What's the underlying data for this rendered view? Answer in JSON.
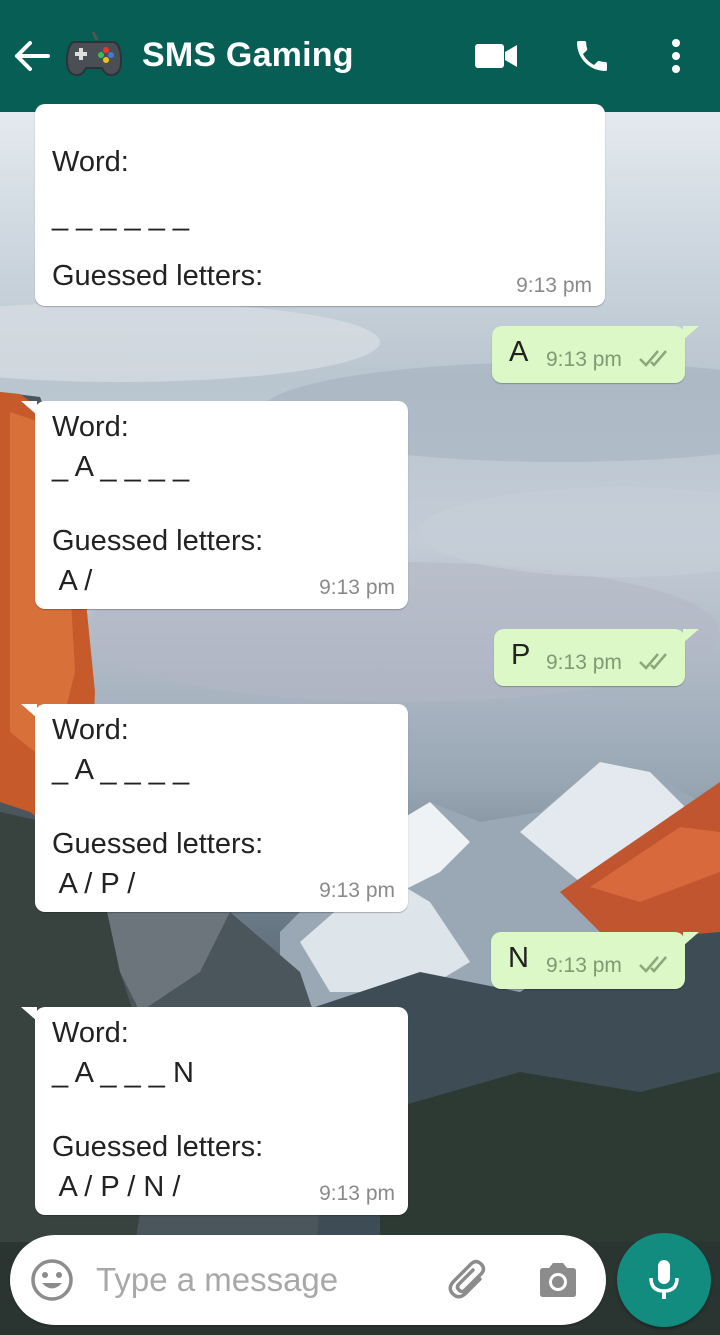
{
  "header": {
    "title": "SMS Gaming",
    "avatar_icon": "gamepad-icon",
    "back_icon": "arrow-left-icon",
    "video_icon": "video-camera-icon",
    "call_icon": "phone-icon",
    "menu_icon": "more-vert-icon",
    "color": "#075e54"
  },
  "messages": [
    {
      "direction": "incoming",
      "lines": [
        "Word:",
        "_ _ _ _ _ _",
        "",
        "Guessed letters:"
      ],
      "time": "9:13 pm"
    },
    {
      "direction": "outgoing",
      "text": "A",
      "time": "9:13 pm",
      "status": "read"
    },
    {
      "direction": "incoming",
      "lines": [
        "Word:",
        "_ A _ _ _ _",
        "",
        "Guessed letters:",
        " A /"
      ],
      "time": "9:13 pm"
    },
    {
      "direction": "outgoing",
      "text": "P",
      "time": "9:13 pm",
      "status": "read"
    },
    {
      "direction": "incoming",
      "lines": [
        "Word:",
        "_ A _ _ _ _",
        "",
        "Guessed letters:",
        " A / P /"
      ],
      "time": "9:13 pm"
    },
    {
      "direction": "outgoing",
      "text": "N",
      "time": "9:13 pm",
      "status": "read"
    },
    {
      "direction": "incoming",
      "lines": [
        "Word:",
        "_ A _ _ _ N",
        "",
        "Guessed letters:",
        " A / P / N /"
      ],
      "time": "9:13 pm"
    }
  ],
  "composer": {
    "placeholder": "Type a message",
    "emoji_icon": "emoji-icon",
    "attach_icon": "paperclip-icon",
    "camera_icon": "camera-icon",
    "mic_icon": "microphone-icon",
    "mic_color": "#128c7e"
  }
}
